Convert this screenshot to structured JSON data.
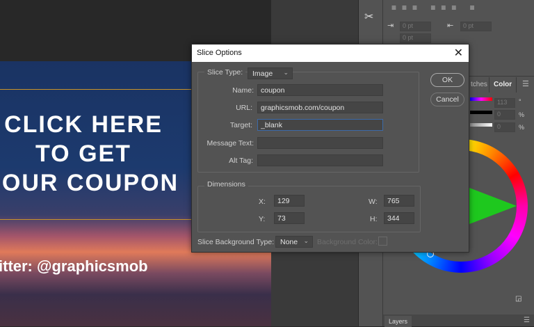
{
  "canvas": {
    "lines": [
      "CLICK HERE",
      "TO GET",
      "OUR COUPON"
    ],
    "twitter": "itter: @graphicsmob"
  },
  "panel": {
    "tabs": [
      "tches",
      "Color"
    ],
    "values": [
      {
        "v": "113",
        "u": "°"
      },
      {
        "v": "0",
        "u": "%"
      },
      {
        "v": "0",
        "u": "%"
      }
    ],
    "indent_values": [
      "0 pt",
      "0 pt",
      "0 pt"
    ],
    "layers_tab": "Layers"
  },
  "dialog": {
    "title": "Slice Options",
    "slice_type_label": "Slice Type:",
    "slice_type": "Image",
    "fields": [
      {
        "label": "Name:",
        "value": "coupon"
      },
      {
        "label": "URL:",
        "value": "graphicsmob.com/coupon"
      },
      {
        "label": "Target:",
        "value": "_blank"
      },
      {
        "label": "Message Text:",
        "value": ""
      },
      {
        "label": "Alt Tag:",
        "value": ""
      }
    ],
    "dimensions_label": "Dimensions",
    "dims": {
      "x_label": "X:",
      "x": "129",
      "y_label": "Y:",
      "y": "73",
      "w_label": "W:",
      "w": "765",
      "h_label": "H:",
      "h": "344"
    },
    "bg_type_label": "Slice Background Type:",
    "bg_type": "None",
    "bg_color_label": "Background Color:",
    "ok": "OK",
    "cancel": "Cancel"
  }
}
